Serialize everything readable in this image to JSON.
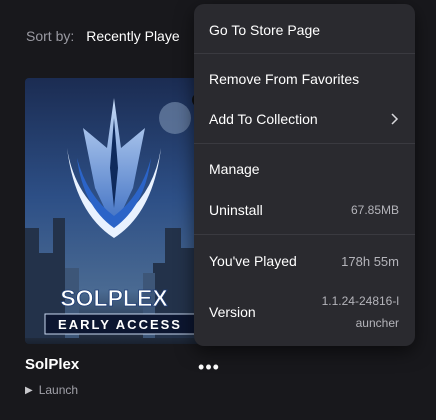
{
  "sort": {
    "label": "Sort by:",
    "value": "Recently Playe"
  },
  "game": {
    "title": "SolPlex",
    "launch_label": "Launch",
    "launch_icon": "play-icon",
    "art_title": "SOLPLEX",
    "art_subtitle": "EARLY ACCESS",
    "more_icon": "ellipsis-icon"
  },
  "menu": {
    "go_to_store": "Go To Store Page",
    "remove_favorites": "Remove From Favorites",
    "add_collection": "Add To Collection",
    "add_collection_icon": "chevron-right-icon",
    "manage": "Manage",
    "uninstall": "Uninstall",
    "uninstall_size": "67.85MB",
    "played_label": "You've Played",
    "played_value": "178h 55m",
    "version_label": "Version",
    "version_line1": "1.1.24-24816-l",
    "version_line2": "auncher"
  },
  "colors": {
    "background": "#18181c",
    "menu_bg": "#2a2a2f",
    "divider": "#3a3a40",
    "muted_text": "#9a9aa2"
  }
}
